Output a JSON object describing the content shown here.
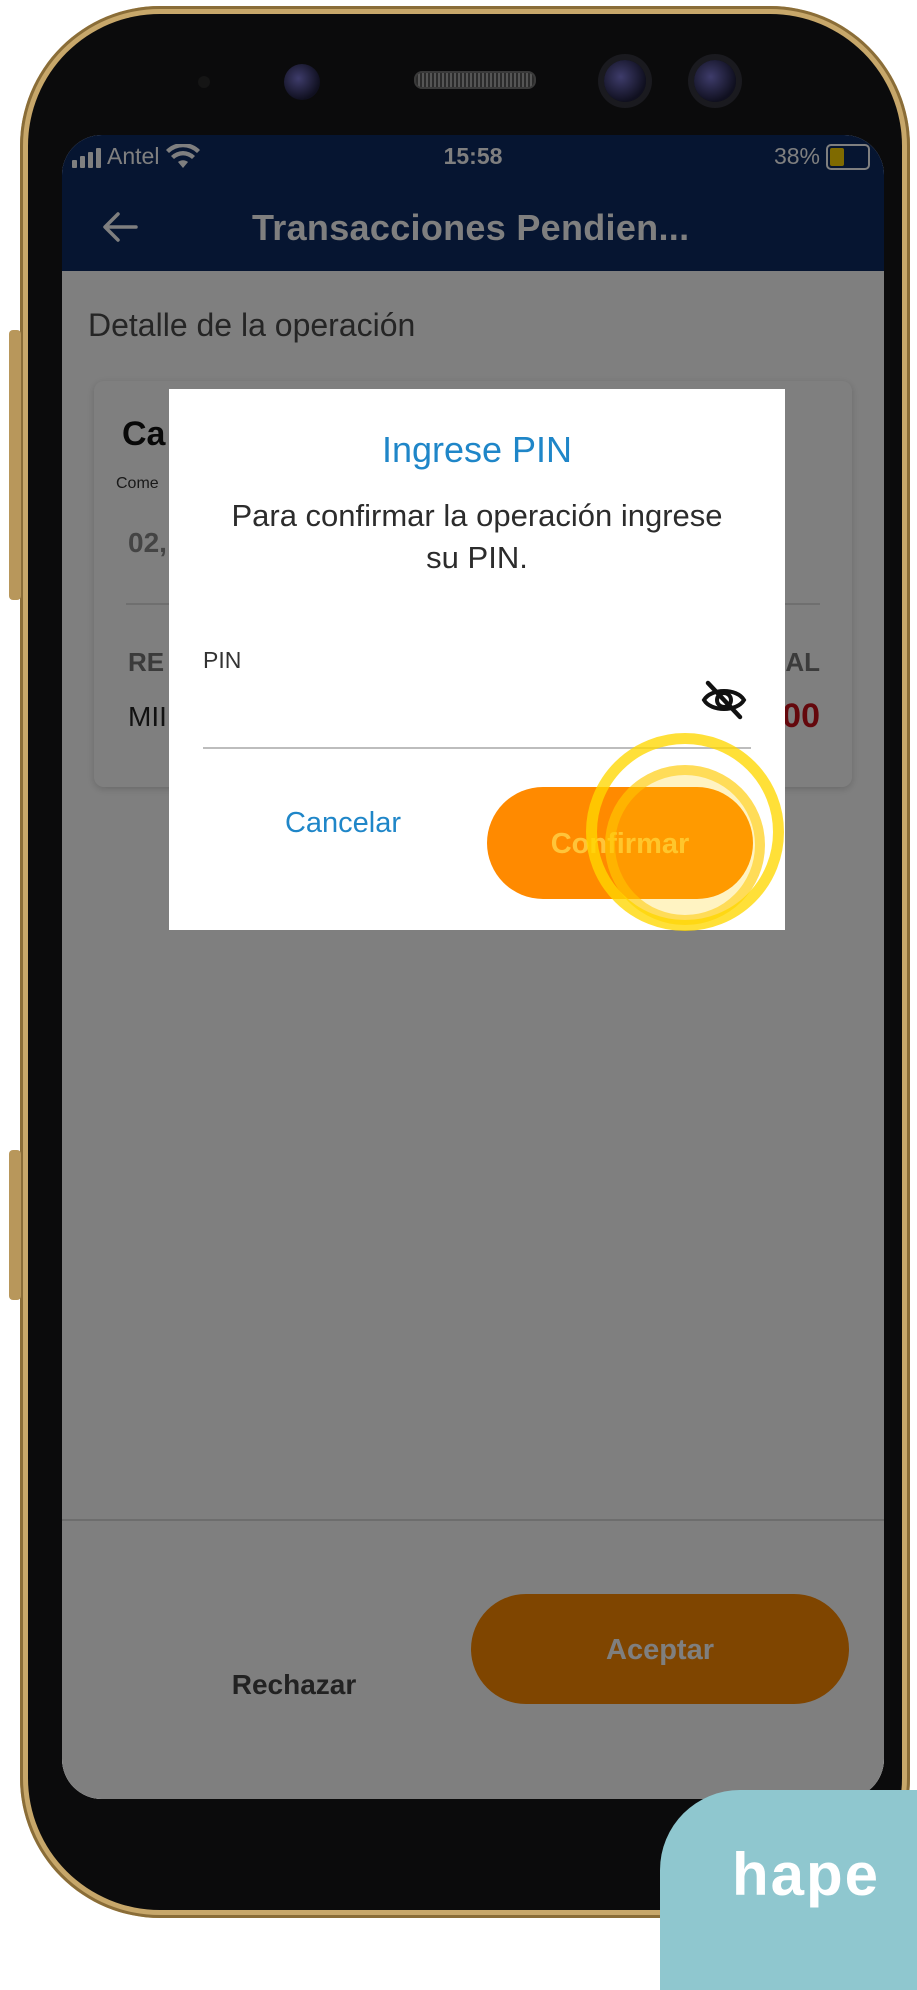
{
  "status_bar": {
    "carrier": "Antel",
    "time": "15:58",
    "battery": "38%"
  },
  "app_bar": {
    "title": "Transacciones Pendien..."
  },
  "content": {
    "section_title": "Detalle de la operación",
    "card": {
      "title_partial": "Ca",
      "subtitle_partial": "Come",
      "date_partial": "02,",
      "label_left_partial": "RE",
      "label_right_partial": "AL",
      "value_left_partial": "MII",
      "value_right_partial": "00"
    }
  },
  "footer": {
    "reject_label": "Rechazar",
    "accept_label": "Aceptar"
  },
  "dialog": {
    "title": "Ingrese PIN",
    "message": "Para confirmar la operación ingrese su PIN.",
    "pin_label": "PIN",
    "cancel_label": "Cancelar",
    "confirm_label": "Confirmar"
  },
  "colors": {
    "app_bar": "#0d2a63",
    "accent_orange": "#ff8a00",
    "link_blue": "#1f86c8",
    "amount_red": "#c8101a",
    "frame_gold": "#c7a76a"
  },
  "icons": [
    "back-arrow-icon",
    "signal-icon",
    "wifi-icon",
    "battery-icon",
    "eye-off-icon"
  ],
  "brand_badge": "hape"
}
